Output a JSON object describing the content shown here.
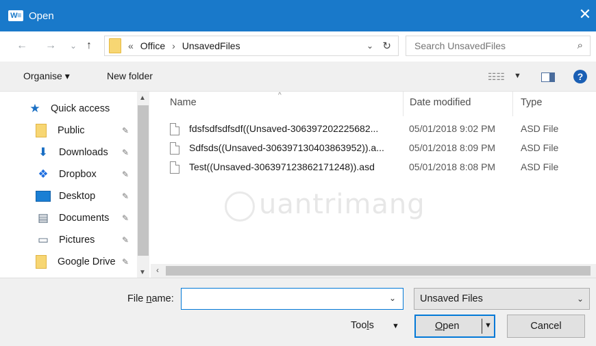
{
  "window": {
    "title": "Open",
    "app_icon_text": "W≡",
    "close_glyph": "✕"
  },
  "nav": {
    "back_glyph": "←",
    "forward_glyph": "→",
    "recent_glyph": "⌄",
    "up_glyph": "↑",
    "breadcrumb": [
      "«",
      "Office",
      "›",
      "UnsavedFiles"
    ],
    "dropdown_glyph": "⌄",
    "refresh_glyph": "↻"
  },
  "search": {
    "placeholder": "Search UnsavedFiles",
    "icon_glyph": "⌕"
  },
  "toolbar": {
    "organise_label": "Organise ▾",
    "new_folder_label": "New folder",
    "view_glyph": "☷☷",
    "view_drop_glyph": "▼",
    "help_glyph": "?"
  },
  "nav_pane": {
    "items": [
      {
        "label": "Quick access",
        "icon": "star-icon",
        "glyph": "★",
        "color": "#1a6fc4",
        "pinned": false
      },
      {
        "label": "Public",
        "icon": "folder-icon",
        "glyph": "",
        "color": "#f7d673",
        "pinned": true
      },
      {
        "label": "Downloads",
        "icon": "download-icon",
        "glyph": "⬇",
        "color": "#1a6fc4",
        "pinned": true
      },
      {
        "label": "Dropbox",
        "icon": "dropbox-icon",
        "glyph": "❖",
        "color": "#1f6fe0",
        "pinned": true
      },
      {
        "label": "Desktop",
        "icon": "desktop-icon",
        "glyph": "",
        "color": "#1a7fd4",
        "pinned": true
      },
      {
        "label": "Documents",
        "icon": "documents-icon",
        "glyph": "▤",
        "color": "#5a6d80",
        "pinned": true
      },
      {
        "label": "Pictures",
        "icon": "pictures-icon",
        "glyph": "▭",
        "color": "#5a6d80",
        "pinned": true
      },
      {
        "label": "Google Drive",
        "icon": "folder-icon",
        "glyph": "",
        "color": "#f7d673",
        "pinned": true
      }
    ],
    "pin_glyph": "📌",
    "scroll_up": "▲",
    "scroll_down": "▼"
  },
  "files": {
    "columns": [
      "Name",
      "Date modified",
      "Type"
    ],
    "sort_glyph": "^",
    "rows": [
      {
        "name": "fdsfsdfsdfsdf((Unsaved-306397202225682...",
        "date": "05/01/2018 9:02 PM",
        "type": "ASD File"
      },
      {
        "name": "Sdfsds((Unsaved-306397130403863952)).a...",
        "date": "05/01/2018 8:09 PM",
        "type": "ASD File"
      },
      {
        "name": "Test((Unsaved-306397123862171248)).asd",
        "date": "05/01/2018 8:08 PM",
        "type": "ASD File"
      }
    ],
    "hscroll_left": "‹",
    "hscroll_right": "›"
  },
  "watermark": "uantrimang",
  "bottom": {
    "file_name_label_pre": "File ",
    "file_name_label_accel": "n",
    "file_name_label_post": "ame:",
    "file_name_value": "",
    "dropdown_glyph": "⌄",
    "file_type": "Unsaved Files",
    "tools_pre": "Too",
    "tools_accel": "l",
    "tools_post": "s",
    "tools_drop": "▼",
    "open_accel": "O",
    "open_post": "pen",
    "open_caret": "▼",
    "cancel_label": "Cancel"
  }
}
